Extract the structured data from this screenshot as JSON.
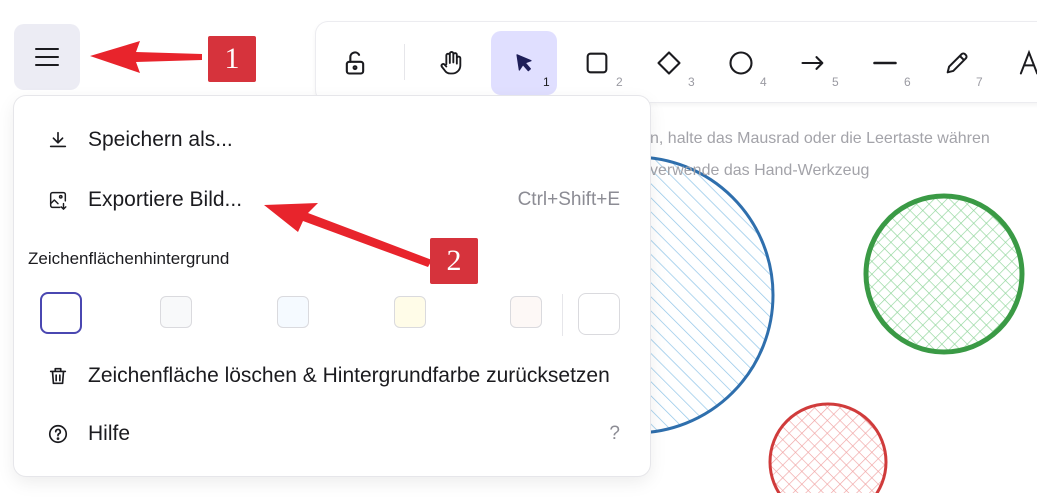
{
  "canvas": {
    "hint_line1": "n, halte das Mausrad oder die Leertaste währen",
    "hint_line2": "verwende das Hand-Werkzeug"
  },
  "toolbar": {
    "tools": [
      {
        "name": "lock",
        "icon": "lock-open-icon",
        "key": ""
      },
      {
        "name": "hand",
        "icon": "hand-icon",
        "key": ""
      },
      {
        "name": "selection",
        "icon": "cursor-arrow-icon",
        "key": "1",
        "active": true
      },
      {
        "name": "rectangle",
        "icon": "square-icon",
        "key": "2"
      },
      {
        "name": "diamond",
        "icon": "diamond-icon",
        "key": "3"
      },
      {
        "name": "ellipse",
        "icon": "circle-icon",
        "key": "4"
      },
      {
        "name": "arrow",
        "icon": "arrow-right-icon",
        "key": "5"
      },
      {
        "name": "line",
        "icon": "line-icon",
        "key": "6"
      },
      {
        "name": "draw",
        "icon": "pencil-icon",
        "key": "7"
      },
      {
        "name": "text",
        "icon": "text-icon",
        "key": ""
      }
    ]
  },
  "menu": {
    "save_as": "Speichern als...",
    "export_image": "Exportiere Bild...",
    "export_shortcut": "Ctrl+Shift+E",
    "background_label": "Zeichenflächenhintergrund",
    "clear_canvas": "Zeichenfläche löschen & Hintergrundfarbe zurücksetzen",
    "help": "Hilfe",
    "help_shortcut": "?"
  },
  "swatches": [
    "#ffffff",
    "#f8f9fa",
    "#f5faff",
    "#fffce8",
    "#fdf8f6"
  ],
  "annotations": {
    "badge1": "1",
    "badge2": "2",
    "badge_color": "#d6333c"
  },
  "colors": {
    "accent": "#e0dfff",
    "selection_border": "#4a47b1",
    "circle_blue": "#2f6fad",
    "circle_green": "#3a9a45",
    "circle_red": "#d03b3b"
  }
}
